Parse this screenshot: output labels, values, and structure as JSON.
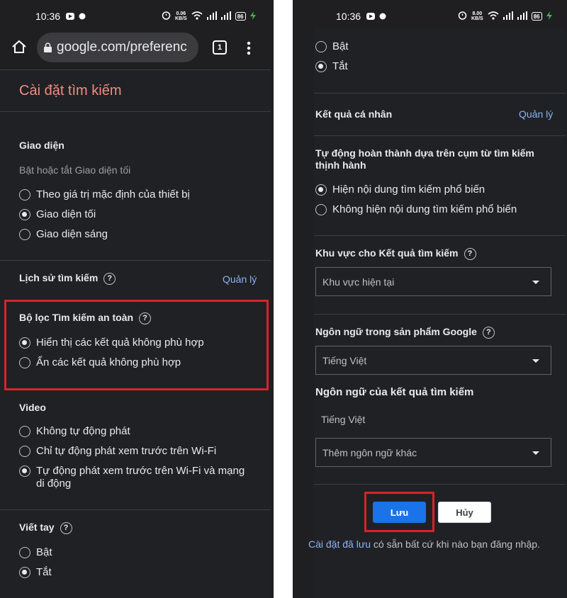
{
  "status_left": {
    "time": "10:36",
    "speed_value": "0.06",
    "speed_unit": "KB/S",
    "battery": "86"
  },
  "status_right": {
    "time": "10:36",
    "speed_value": "8.00",
    "speed_unit": "KB/S",
    "battery": "86"
  },
  "browser": {
    "url": "google.com/preferenc",
    "tab_count": "1"
  },
  "left": {
    "page_title": "Cài đặt tìm kiếm",
    "appearance": {
      "title": "Giao diện",
      "description": "Bật hoặc tắt Giao diện tối",
      "options": [
        "Theo giá trị mặc định của thiết bị",
        "Giao diện tối",
        "Giao diện sáng"
      ],
      "selected": 1
    },
    "history": {
      "title": "Lịch sử tìm kiếm",
      "manage": "Quản lý",
      "help": "?"
    },
    "safesearch": {
      "title": "Bộ lọc Tìm kiếm an toàn",
      "help": "?",
      "options": [
        "Hiển thị các kết quả không phù hợp",
        "Ẩn các kết quả không phù hợp"
      ],
      "selected": 0
    },
    "video": {
      "title": "Video",
      "options": [
        "Không tự động phát",
        "Chỉ tự động phát xem trước trên Wi-Fi",
        "Tự động phát xem trước trên Wi-Fi và mạng di động"
      ],
      "selected": 2
    },
    "handwriting": {
      "title": "Viết tay",
      "help": "?",
      "options": [
        "Bật",
        "Tắt"
      ],
      "selected": 1
    }
  },
  "right": {
    "handwriting_options": [
      "Bật",
      "Tắt"
    ],
    "handwriting_selected": 1,
    "personal": {
      "title": "Kết quả cá nhân",
      "manage": "Quản lý"
    },
    "autocomplete": {
      "title": "Tự động hoàn thành dựa trên cụm từ tìm kiếm thịnh hành",
      "options": [
        "Hiện nội dung tìm kiếm phổ biến",
        "Không hiện nội dung tìm kiếm phổ biến"
      ],
      "selected": 0
    },
    "region": {
      "title": "Khu vực cho Kết quả tìm kiếm",
      "help": "?",
      "value": "Khu vực hiện tại"
    },
    "language": {
      "title": "Ngôn ngữ trong sản phẩm Google",
      "help": "?",
      "value": "Tiếng Việt"
    },
    "results_language": {
      "title": "Ngôn ngữ của kết quả tìm kiếm",
      "current": "Tiếng Việt",
      "add": "Thêm ngôn ngữ khác"
    },
    "save_label": "Lưu",
    "cancel_label": "Hủy",
    "saved_link": "Cài đặt đã lưu",
    "saved_text": " có sẵn bất cứ khi nào bạn đăng nhập."
  },
  "colors": {
    "accent": "#1a73e8",
    "link": "#8ab4f8",
    "highlight": "#d9222a",
    "title": "#f28b82"
  }
}
